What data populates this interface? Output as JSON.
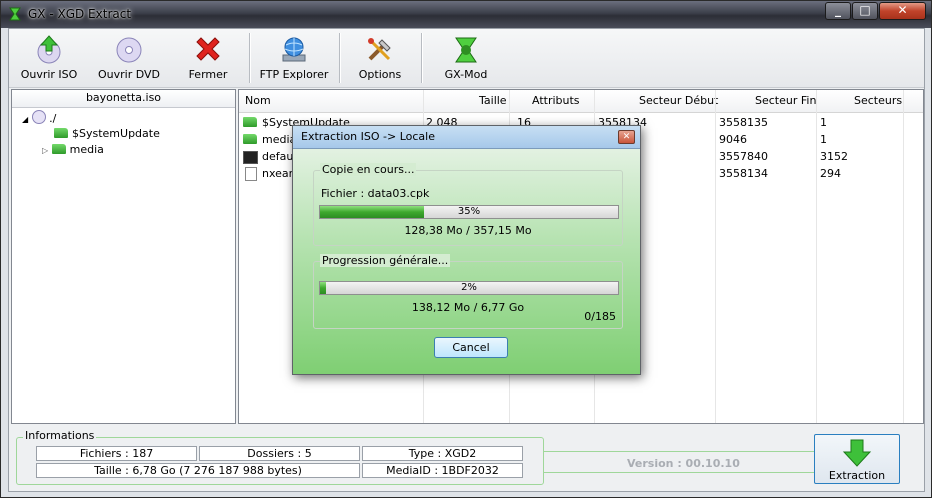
{
  "window": {
    "title": "GX - XGD Extract"
  },
  "toolbar": {
    "open_iso": "Ouvrir ISO",
    "open_dvd": "Ouvrir DVD",
    "close": "Fermer",
    "ftp": "FTP Explorer",
    "options": "Options",
    "gxmod": "GX-Mod"
  },
  "tree": {
    "header": "bayonetta.iso",
    "root": "./",
    "items": [
      "$SystemUpdate",
      "media"
    ]
  },
  "list": {
    "columns": [
      "Nom",
      "Taille",
      "Attributs",
      "Secteur Début",
      "Secteur Fin",
      "Secteurs"
    ],
    "rows": [
      {
        "name": "$SystemUpdate",
        "size": "2 048",
        "attr": "16",
        "start": "3558134",
        "end": "3558135",
        "sectors": "1"
      },
      {
        "name": "media",
        "size": "",
        "attr": "",
        "start": "",
        "end": "9046",
        "sectors": "1"
      },
      {
        "name": "default.xex",
        "size": "",
        "attr": "",
        "start": "",
        "end": "3557840",
        "sectors": "3152"
      },
      {
        "name": "nxeart",
        "size": "",
        "attr": "",
        "start": "",
        "end": "3558134",
        "sectors": "294"
      }
    ]
  },
  "info": {
    "legend": "Informations",
    "files": "Fichiers : 187",
    "folders": "Dossiers : 5",
    "type": "Type : XGD2",
    "size": "Taille : 6,78 Go (7 276 187 988 bytes)",
    "mediaid": "MediaID : 1BDF2032"
  },
  "version": "Version : 00.10.10",
  "extract_label": "Extraction",
  "dialog": {
    "title": "Extraction ISO -> Locale",
    "copy_group": "Copie en cours...",
    "file_label": "Fichier : data03.cpk",
    "file_progress": 0.35,
    "file_percent": "35%",
    "file_sizes": "128,38 Mo / 357,15 Mo",
    "general_group": "Progression générale...",
    "general_progress": 0.02,
    "general_percent": "2%",
    "general_sizes": "138,12 Mo / 6,77 Go",
    "count": "0/185",
    "cancel": "Cancel"
  }
}
